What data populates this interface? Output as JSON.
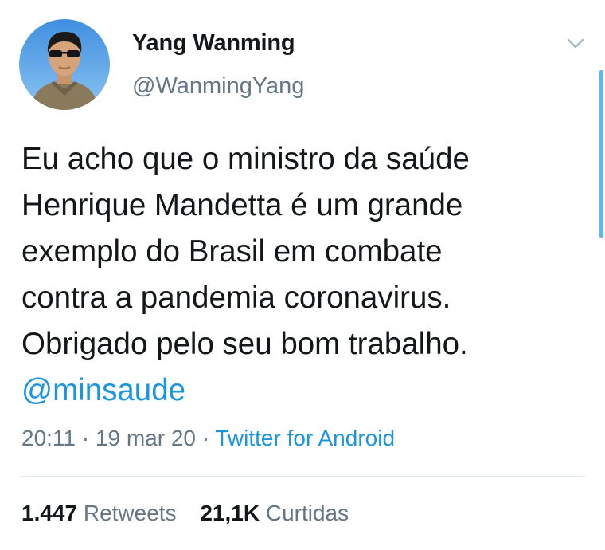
{
  "author": {
    "name": "Yang Wanming",
    "handle": "@WanmingYang"
  },
  "tweet": {
    "lines": [
      "Eu acho que o ministro da saúde",
      "Henrique Mandetta é um grande",
      "exemplo do Brasil em combate",
      "contra a pandemia coronavirus.",
      "Obrigado pelo seu bom trabalho."
    ],
    "mention": "@minsaude"
  },
  "meta": {
    "time": "20:11",
    "separator": "·",
    "date": "19 mar 20",
    "source": "Twitter for Android"
  },
  "stats": {
    "retweets_count": "1.447",
    "retweets_label": "Retweets",
    "likes_count": "21,1K",
    "likes_label": "Curtidas"
  },
  "icons": {
    "menu": "chevron-down-icon"
  },
  "colors": {
    "link": "#1b95e0",
    "text": "#14171a",
    "secondary": "#657786",
    "scrollbar": "#5eb5f3"
  }
}
